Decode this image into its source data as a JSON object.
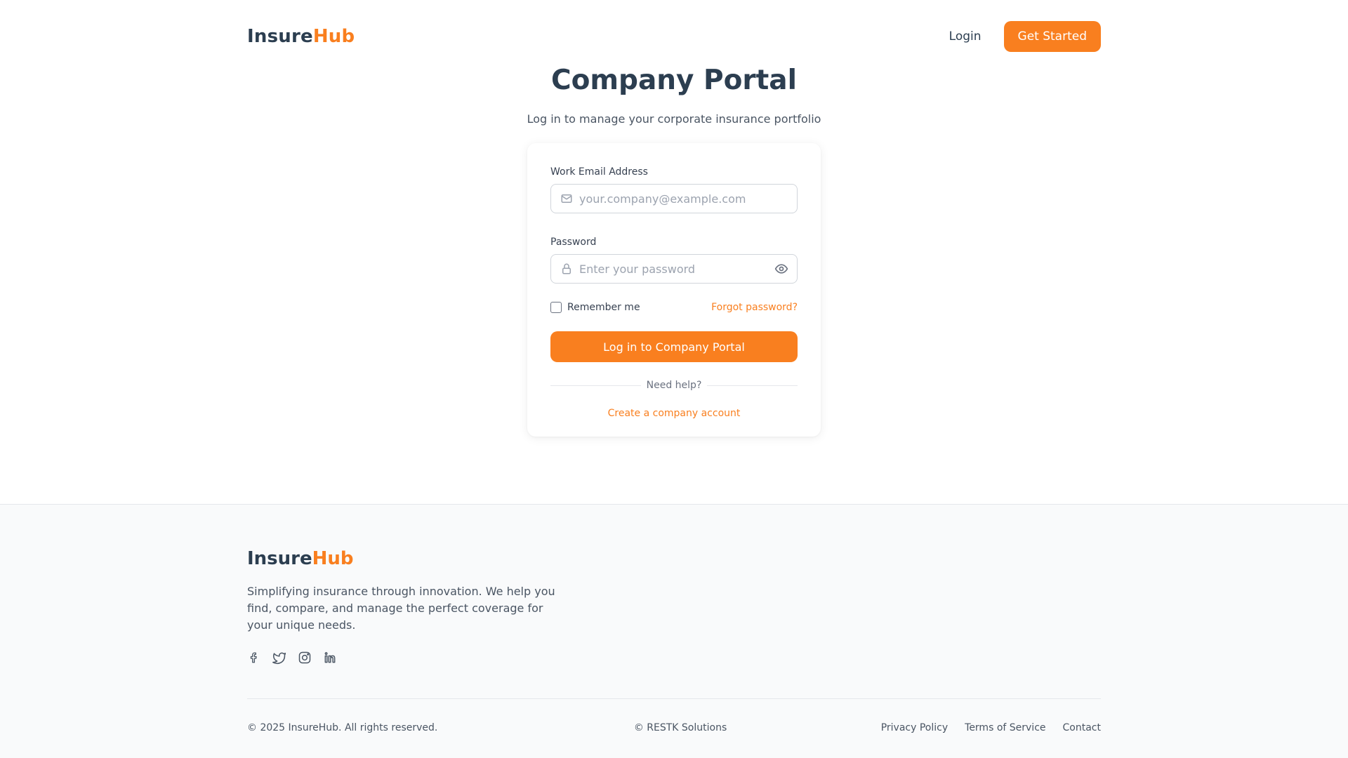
{
  "brand": {
    "name_main": "Insure",
    "name_accent": "Hub",
    "accent_color": "#f97f1f"
  },
  "header": {
    "login_label": "Login",
    "get_started_label": "Get Started"
  },
  "hero": {
    "title": "Company Portal",
    "subtitle": "Log in to manage your corporate insurance portfolio"
  },
  "form": {
    "email_label": "Work Email Address",
    "email_placeholder": "your.company@example.com",
    "email_icon": "mail-icon",
    "password_label": "Password",
    "password_placeholder": "Enter your password",
    "password_icon": "lock-icon",
    "toggle_icon": "eye-icon",
    "remember_label": "Remember me",
    "remember_checked": false,
    "forgot_label": "Forgot password?",
    "submit_label": "Log in to Company Portal",
    "help_label": "Need help?",
    "create_label": "Create a company account"
  },
  "footer": {
    "description": "Simplifying insurance through innovation. We help you find, compare, and manage the perfect coverage for your unique needs.",
    "socials": [
      "facebook-icon",
      "twitter-icon",
      "instagram-icon",
      "linkedin-icon"
    ],
    "copyright": "© 2025 InsureHub. All rights reserved.",
    "credit": "© RESTK Solutions",
    "links": [
      "Privacy Policy",
      "Terms of Service",
      "Contact"
    ]
  }
}
